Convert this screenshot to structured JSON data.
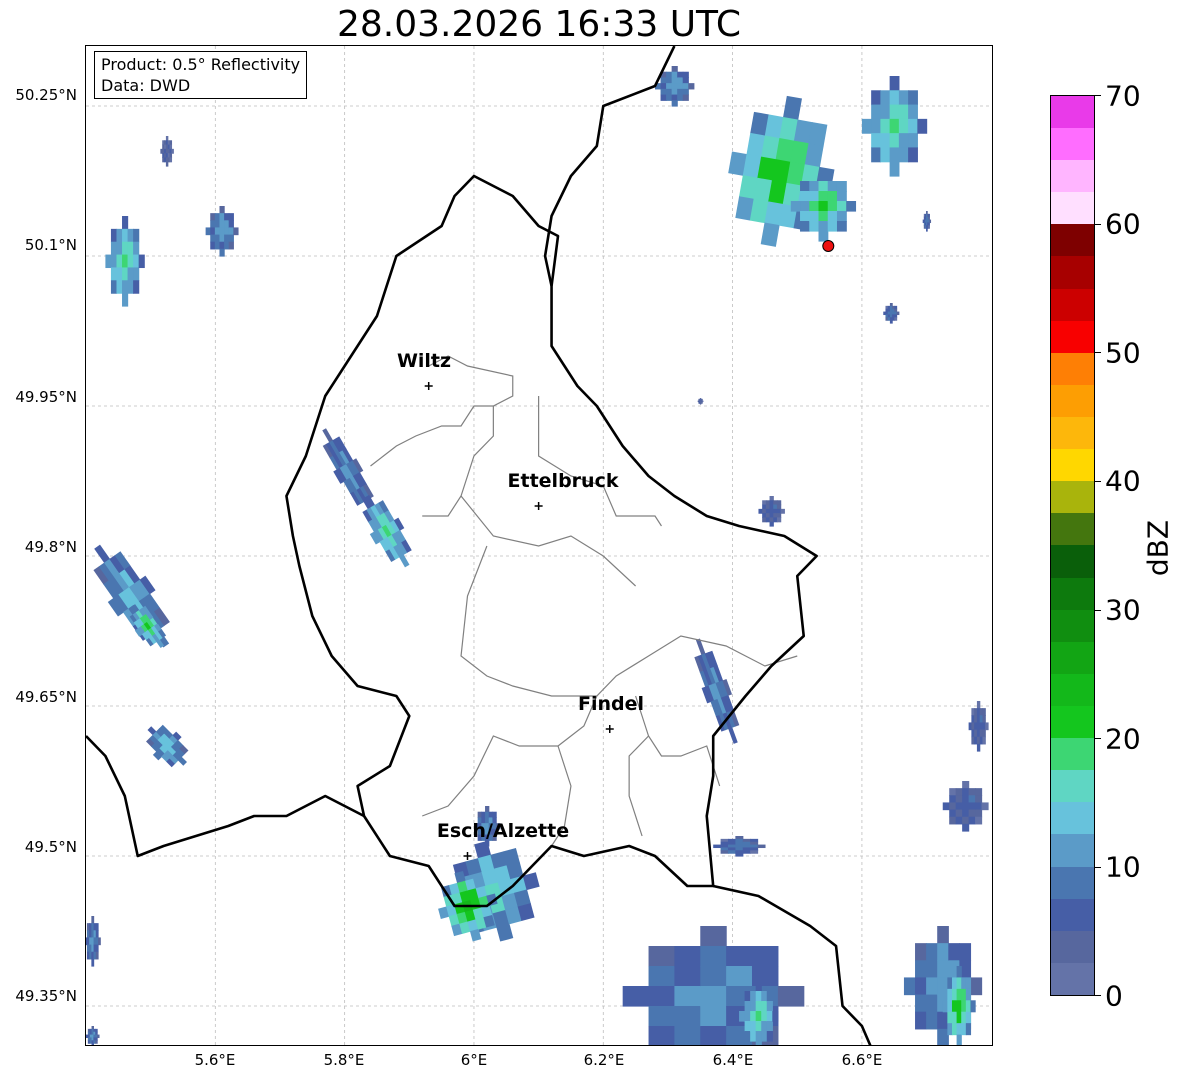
{
  "title": "28.03.2026 16:33 UTC",
  "info_box": {
    "product": "Product: 0.5° Reflectivity",
    "source": "Data: DWD"
  },
  "latitude_labels": [
    "50.25°N",
    "50.1°N",
    "49.95°N",
    "49.8°N",
    "49.65°N",
    "49.5°N",
    "49.35°N"
  ],
  "longitude_labels": [
    "5.6°E",
    "5.8°E",
    "6°E",
    "6.2°E",
    "6.4°E",
    "6.6°E"
  ],
  "cities": [
    {
      "name": "Wiltz",
      "lon": 5.93,
      "lat": 49.97
    },
    {
      "name": "Ettelbruck",
      "lon": 6.1,
      "lat": 49.85
    },
    {
      "name": "Findel",
      "lon": 6.21,
      "lat": 49.627
    },
    {
      "name": "Esch/Alzette",
      "lon": 5.99,
      "lat": 49.5
    }
  ],
  "radar_site": {
    "lon": 6.548,
    "lat": 50.11,
    "color": "#ee1111"
  },
  "colorbar": {
    "unit": "dBZ",
    "min": 0,
    "max": 70,
    "tick_labels": [
      "0",
      "10",
      "20",
      "30",
      "40",
      "50",
      "60",
      "70"
    ],
    "colors": [
      "#6473a8",
      "#57679e",
      "#465ea6",
      "#4a76b0",
      "#5b9bc8",
      "#67c2dc",
      "#5fd6c3",
      "#3dd673",
      "#14c61e",
      "#13b81a",
      "#12a514",
      "#108e10",
      "#0d7a0d",
      "#0a5f0a",
      "#44760e",
      "#a9b40c",
      "#ffd700",
      "#fdb70b",
      "#fd9e03",
      "#fe7f05",
      "#f80000",
      "#cc0000",
      "#a70000",
      "#7e0000",
      "#ffdfff",
      "#ffb5ff",
      "#ff6dff",
      "#e93ae9"
    ]
  },
  "colors": {
    "border": "#000000",
    "commune_lines": "#808080",
    "grid": "#bdbdbd"
  },
  "echoes": [
    {
      "lon": 5.46,
      "lat": 50.095,
      "w": 0.03,
      "h": 0.045,
      "lvl": 20,
      "rot": 0
    },
    {
      "lon": 5.61,
      "lat": 50.125,
      "w": 0.025,
      "h": 0.025,
      "lvl": 14,
      "rot": 0
    },
    {
      "lon": 5.525,
      "lat": 50.205,
      "w": 0.01,
      "h": 0.015,
      "lvl": 6,
      "rot": 0
    },
    {
      "lon": 5.805,
      "lat": 49.885,
      "w": 0.02,
      "h": 0.048,
      "lvl": 12,
      "rot": -30
    },
    {
      "lon": 5.865,
      "lat": 49.825,
      "w": 0.025,
      "h": 0.04,
      "lvl": 20,
      "rot": -30
    },
    {
      "lon": 5.47,
      "lat": 49.76,
      "w": 0.035,
      "h": 0.06,
      "lvl": 15,
      "rot": -35
    },
    {
      "lon": 5.495,
      "lat": 49.73,
      "w": 0.02,
      "h": 0.025,
      "lvl": 22,
      "rot": -35
    },
    {
      "lon": 5.525,
      "lat": 49.61,
      "w": 0.025,
      "h": 0.025,
      "lvl": 16,
      "rot": -45
    },
    {
      "lon": 6.375,
      "lat": 49.665,
      "w": 0.02,
      "h": 0.055,
      "lvl": 12,
      "rot": -20
    },
    {
      "lon": 6.46,
      "lat": 49.845,
      "w": 0.02,
      "h": 0.015,
      "lvl": 8,
      "rot": 0
    },
    {
      "lon": 6.475,
      "lat": 50.185,
      "w": 0.08,
      "h": 0.075,
      "lvl": 24,
      "rot": 10
    },
    {
      "lon": 6.65,
      "lat": 50.23,
      "w": 0.05,
      "h": 0.05,
      "lvl": 20,
      "rot": 0
    },
    {
      "lon": 6.54,
      "lat": 50.15,
      "w": 0.05,
      "h": 0.035,
      "lvl": 22,
      "rot": 0
    },
    {
      "lon": 6.31,
      "lat": 50.27,
      "w": 0.03,
      "h": 0.02,
      "lvl": 14,
      "rot": 0
    },
    {
      "lon": 6.645,
      "lat": 50.043,
      "w": 0.012,
      "h": 0.01,
      "lvl": 10,
      "rot": 0
    },
    {
      "lon": 6.7,
      "lat": 50.135,
      "w": 0.006,
      "h": 0.01,
      "lvl": 10,
      "rot": 0
    },
    {
      "lon": 6.35,
      "lat": 49.955,
      "w": 0.004,
      "h": 0.003,
      "lvl": 6,
      "rot": 0
    },
    {
      "lon": 6.03,
      "lat": 49.465,
      "w": 0.07,
      "h": 0.05,
      "lvl": 18,
      "rot": -15
    },
    {
      "lon": 5.99,
      "lat": 49.45,
      "w": 0.045,
      "h": 0.035,
      "lvl": 26,
      "rot": -15
    },
    {
      "lon": 6.02,
      "lat": 49.53,
      "w": 0.02,
      "h": 0.02,
      "lvl": 12,
      "rot": 0
    },
    {
      "lon": 6.37,
      "lat": 49.36,
      "w": 0.14,
      "h": 0.07,
      "lvl": 12,
      "rot": 0
    },
    {
      "lon": 6.44,
      "lat": 49.34,
      "w": 0.03,
      "h": 0.035,
      "lvl": 20,
      "rot": 0
    },
    {
      "lon": 6.41,
      "lat": 49.51,
      "w": 0.04,
      "h": 0.01,
      "lvl": 10,
      "rot": 0
    },
    {
      "lon": 6.725,
      "lat": 49.37,
      "w": 0.06,
      "h": 0.06,
      "lvl": 14,
      "rot": 0
    },
    {
      "lon": 6.75,
      "lat": 49.35,
      "w": 0.025,
      "h": 0.04,
      "lvl": 24,
      "rot": 0
    },
    {
      "lon": 6.76,
      "lat": 49.55,
      "w": 0.035,
      "h": 0.025,
      "lvl": 8,
      "rot": 0
    },
    {
      "lon": 6.78,
      "lat": 49.63,
      "w": 0.015,
      "h": 0.025,
      "lvl": 8,
      "rot": 0
    },
    {
      "lon": 5.41,
      "lat": 49.415,
      "w": 0.012,
      "h": 0.025,
      "lvl": 12,
      "rot": 0
    },
    {
      "lon": 5.41,
      "lat": 49.32,
      "w": 0.01,
      "h": 0.01,
      "lvl": 12,
      "rot": 0
    }
  ]
}
